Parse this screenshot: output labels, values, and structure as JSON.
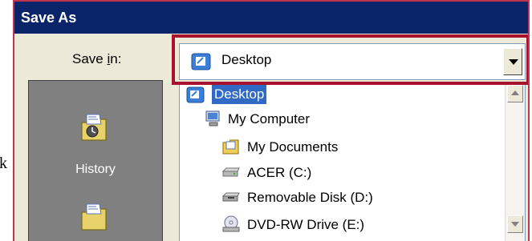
{
  "window": {
    "title": "Save As"
  },
  "stray_text": "k",
  "save_in": {
    "label_pre": "Save ",
    "label_ul": "i",
    "label_post": "n:",
    "selected_value": "Desktop",
    "selected_icon": "desktop-folder-icon"
  },
  "places": [
    {
      "label": "History",
      "icon": "history-folder-icon"
    },
    {
      "label": "",
      "icon": "my-documents-folder-icon"
    }
  ],
  "dropdown": {
    "items": [
      {
        "label": "Desktop",
        "icon": "desktop-folder-icon",
        "selected": true
      },
      {
        "label": "My Computer",
        "icon": "my-computer-icon"
      },
      {
        "label": "My Documents",
        "icon": "my-documents-folder-icon"
      },
      {
        "label": "ACER (C:)",
        "icon": "hard-drive-icon"
      },
      {
        "label": "Removable Disk (D:)",
        "icon": "removable-disk-icon"
      },
      {
        "label": "DVD-RW Drive (E:)",
        "icon": "dvd-drive-icon"
      }
    ]
  },
  "colors": {
    "title_bar": "#0a246a",
    "dialog_face": "#ece9d8",
    "highlight_frame": "#a8122e",
    "selection": "#316ac5"
  }
}
